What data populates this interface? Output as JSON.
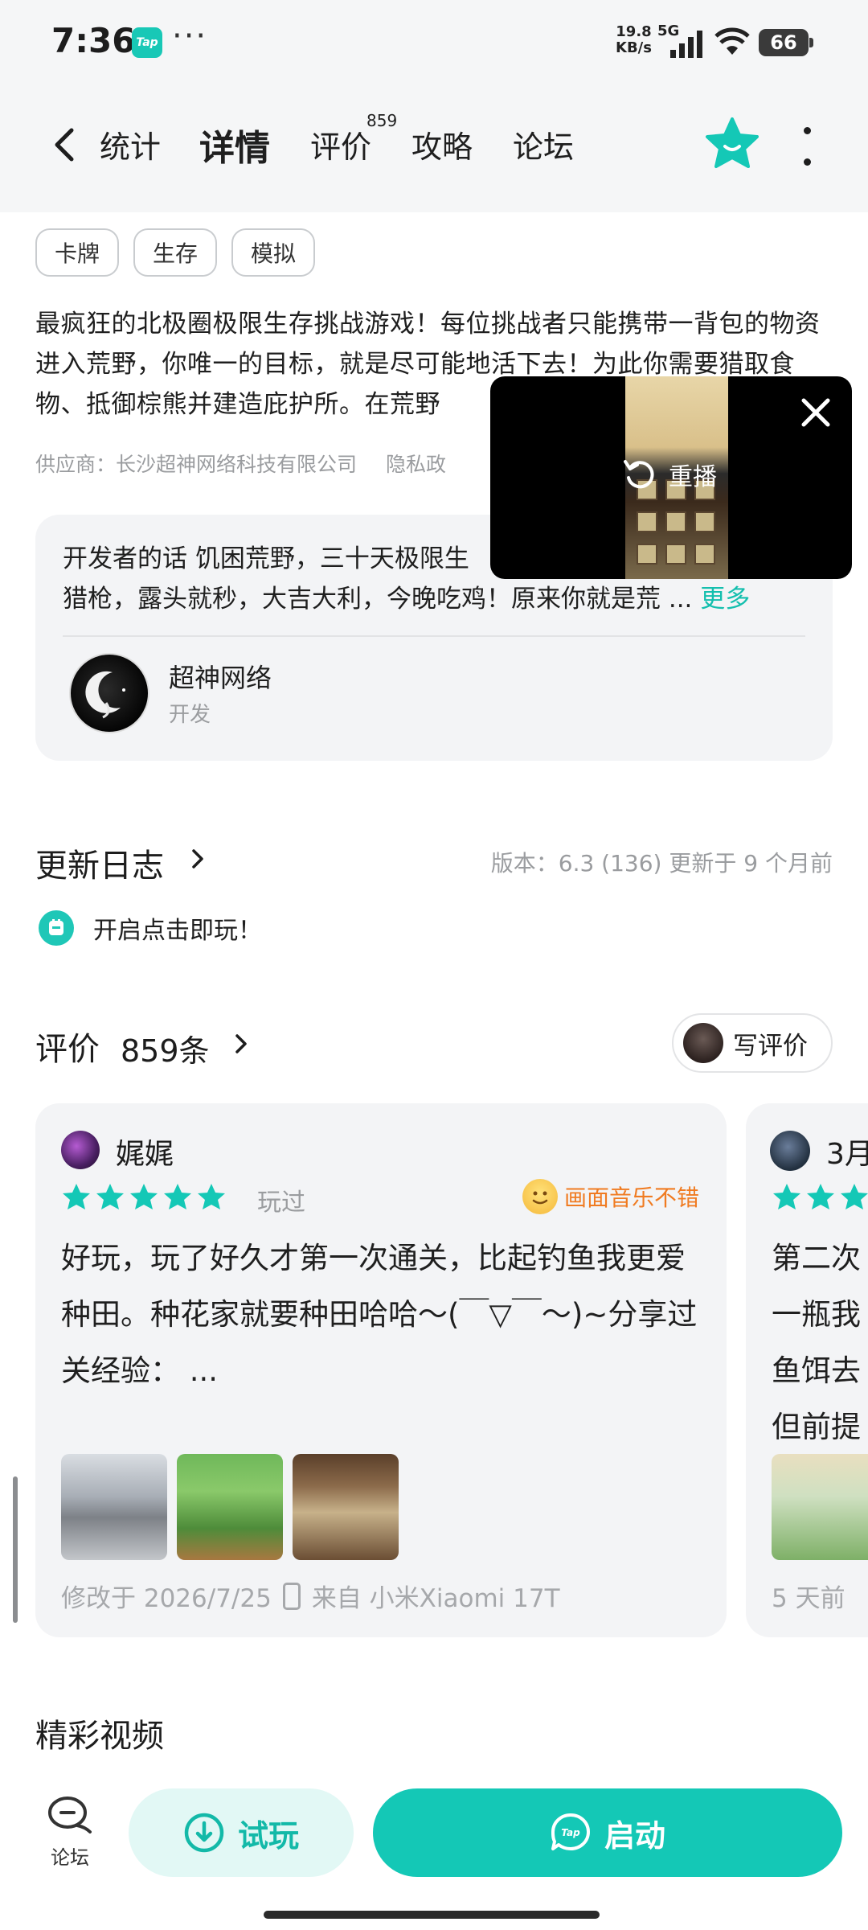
{
  "status_bar": {
    "time": "7:36",
    "app_badge": "Tap",
    "dots": "···",
    "speed_value": "19.8",
    "speed_unit": "KB/s",
    "network": "5G",
    "battery": "66"
  },
  "header": {
    "tabs": [
      {
        "label": "统计"
      },
      {
        "label": "详情"
      },
      {
        "label": "评价"
      },
      {
        "label": "攻略"
      },
      {
        "label": "论坛"
      }
    ],
    "review_badge": "859",
    "active_tab": "详情"
  },
  "tags": [
    "卡牌",
    "生存",
    "模拟"
  ],
  "description": "最疯狂的北极圈极限生存挑战游戏！每位挑战者只能携带一背包的物资进入荒野，你唯一的目标，就是尽可能地活下去！为此你需要猎取食物、抵御棕熊并建造庇护所。在荒野",
  "supplier": {
    "text": "供应商：长沙超神网络科技有限公司",
    "privacy": "隐私政"
  },
  "developer": {
    "line1": "开发者的话  饥困荒野，三十天极限生",
    "line2": "猎枪，露头就秒，大吉大利，今晚吃鸡！原来你就是荒 ...",
    "more": "更多",
    "name": "超神网络",
    "role": "开发"
  },
  "video_popup": {
    "replay_label": "重播"
  },
  "update_log": {
    "title": "更新日志",
    "meta": "版本：6.3 (136)  更新于 9 个月前",
    "item": "开启点击即玩！"
  },
  "reviews": {
    "title": "评价",
    "count": "859条",
    "write_label": "写评价",
    "items": [
      {
        "name": "娓娓",
        "rating": 5,
        "status": "玩过",
        "tag": "画面音乐不错",
        "text": "好玩，玩了好久才第一次通关，比起钓鱼我更爱种田。种花家就要种田哈哈～(￣▽￣～)~分享过关经验：  ...",
        "modified": "修改于 2026/7/25",
        "device": "来自 小米Xiaomi 17T"
      },
      {
        "name": "3月",
        "rating": 5,
        "text_lines": [
          "第二次",
          "一瓶我",
          "鱼饵去",
          "但前提"
        ],
        "time": "5 天前"
      }
    ]
  },
  "videos": {
    "title": "精彩视频"
  },
  "bottom_bar": {
    "forum_label": "论坛",
    "try_label": "试玩",
    "launch_label": "启动"
  },
  "colors": {
    "accent": "#14c8b6",
    "accent_light": "#e2f8f5",
    "tag_orange": "#f07b21",
    "muted": "#9a9c9f"
  }
}
